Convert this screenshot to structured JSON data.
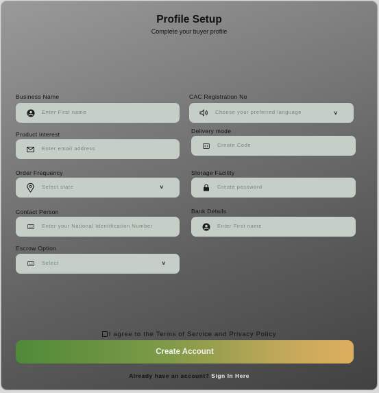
{
  "header": {
    "title": "Profile Setup",
    "subtitle": "Complete your buyer profile"
  },
  "form": {
    "business_name": {
      "label": "Business Name",
      "placeholder": "Enter First name",
      "icon": "person-circle-icon"
    },
    "cac_registration": {
      "label": "CAC Registration No",
      "placeholder": "Choose your preferred language",
      "icon": "speaker-icon",
      "chevron": "v"
    },
    "product_interest": {
      "label": "Product interest",
      "placeholder": "Enter email address",
      "icon": "mail-icon"
    },
    "delivery_mode": {
      "label": "Delivery mode",
      "placeholder": "Create Code",
      "icon": "code-icon"
    },
    "order_frequency": {
      "label": "Order Frequency",
      "placeholder": "Select state",
      "icon": "location-pin-icon",
      "chevron": "v"
    },
    "storage_facility": {
      "label": "Storage Facility",
      "placeholder": "Create password",
      "icon": "lock-icon"
    },
    "contact_person": {
      "label": "Contact Person",
      "placeholder": "Enter your National Identification Number",
      "icon": "id-number-icon"
    },
    "bank_details": {
      "label": "Bank Details",
      "placeholder": "Enter First name",
      "icon": "person-circle-icon"
    },
    "escrow_option": {
      "label": "Escrow Option",
      "placeholder": "Select",
      "icon": "id-number-icon",
      "chevron": "v"
    }
  },
  "terms": {
    "text": "I agree to the Terms of Service and Privacy Policy"
  },
  "actions": {
    "create_account": "Create Account"
  },
  "footer": {
    "prompt": "Already have an account? ",
    "link": "Sign In Here"
  },
  "colors": {
    "field_bg": "#c6cec8",
    "placeholder": "#6f8a77",
    "button_gradient_start": "#4f8a37",
    "button_gradient_end": "#dcaf5e"
  }
}
